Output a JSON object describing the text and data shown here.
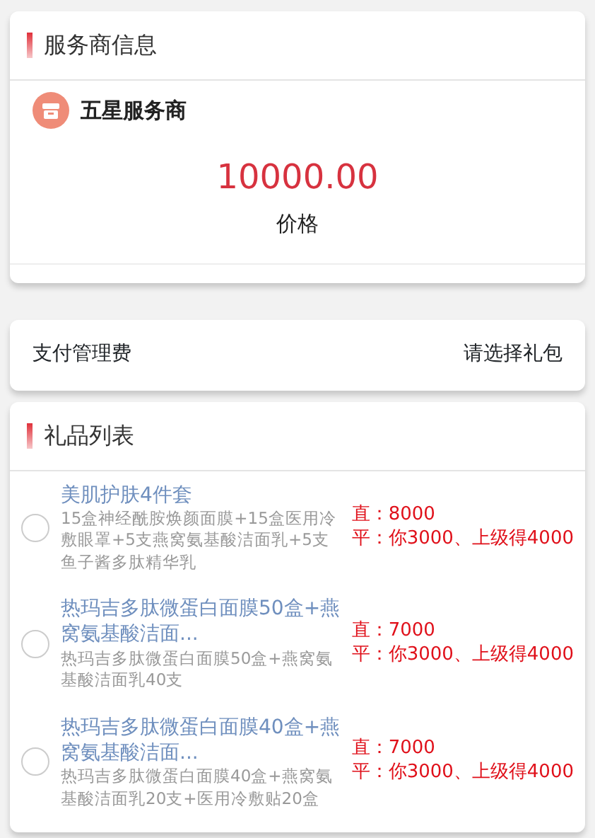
{
  "provider_section": {
    "title": "服务商信息",
    "provider_name": "五星服务商",
    "price": "10000.00",
    "price_label": "价格"
  },
  "payment": {
    "label": "支付管理费",
    "value": "请选择礼包"
  },
  "gift_section": {
    "title": "礼品列表",
    "items": [
      {
        "title": "美肌护肤4件套",
        "description": "15盒神经酰胺焕颜面膜+15盒医用冷敷眼罩+5支燕窝氨基酸洁面乳+5支鱼子酱多肽精华乳",
        "selected": false,
        "notes": [
          "直：8000",
          "平：你3000、上级得4000"
        ]
      },
      {
        "title": "热玛吉多肽微蛋白面膜50盒+燕窝氨基酸洁面...",
        "description": "热玛吉多肽微蛋白面膜50盒+燕窝氨基酸洁面乳40支",
        "selected": false,
        "notes": [
          "直：7000",
          "平：你3000、上级得4000"
        ]
      },
      {
        "title": "热玛吉多肽微蛋白面膜40盒+燕窝氨基酸洁面...",
        "description": "热玛吉多肽微蛋白面膜40盒+燕窝氨基酸洁面乳20支+医用冷敷贴20盒",
        "selected": false,
        "notes": [
          "直：7000",
          "平：你3000、上级得4000"
        ]
      }
    ]
  }
}
